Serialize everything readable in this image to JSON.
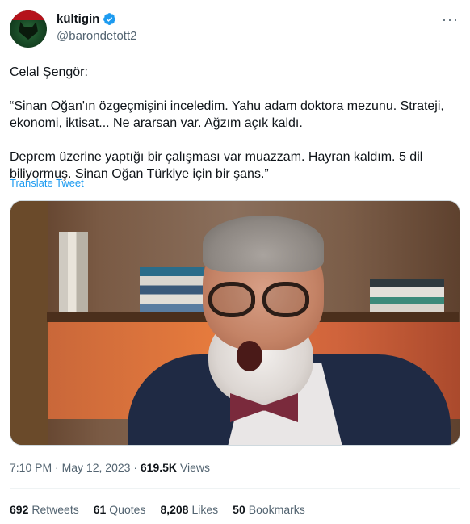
{
  "author": {
    "display_name": "kültigin",
    "handle": "@barondetott2",
    "verified": true,
    "avatar_icon": "wolf-avatar-icon"
  },
  "more_label": "···",
  "tweet": {
    "line1": "Celal Şengör:",
    "line2": "“Sinan Oğan'ın özgeçmişini inceledim. Yahu adam doktora mezunu. Strateji, ekonomi, iktisat... Ne ararsan var. Ağzım açık kaldı.",
    "line3": "Deprem üzerine yaptığı bir çalışması var muazzam. Hayran kaldım. 5 dil biliyormuş. Sinan Oğan Türkiye için bir şans.”"
  },
  "translate_label": "Translate Tweet",
  "meta": {
    "time": "7:10 PM",
    "separator": "·",
    "date": "May 12, 2023",
    "views_count": "619.5K",
    "views_label": "Views"
  },
  "stats": [
    {
      "count": "692",
      "label": "Retweets"
    },
    {
      "count": "61",
      "label": "Quotes"
    },
    {
      "count": "8,208",
      "label": "Likes"
    },
    {
      "count": "50",
      "label": "Bookmarks"
    }
  ],
  "colors": {
    "link": "#1d9bf0",
    "muted": "#536471",
    "text": "#0f1419",
    "verified": "#1d9bf0"
  }
}
